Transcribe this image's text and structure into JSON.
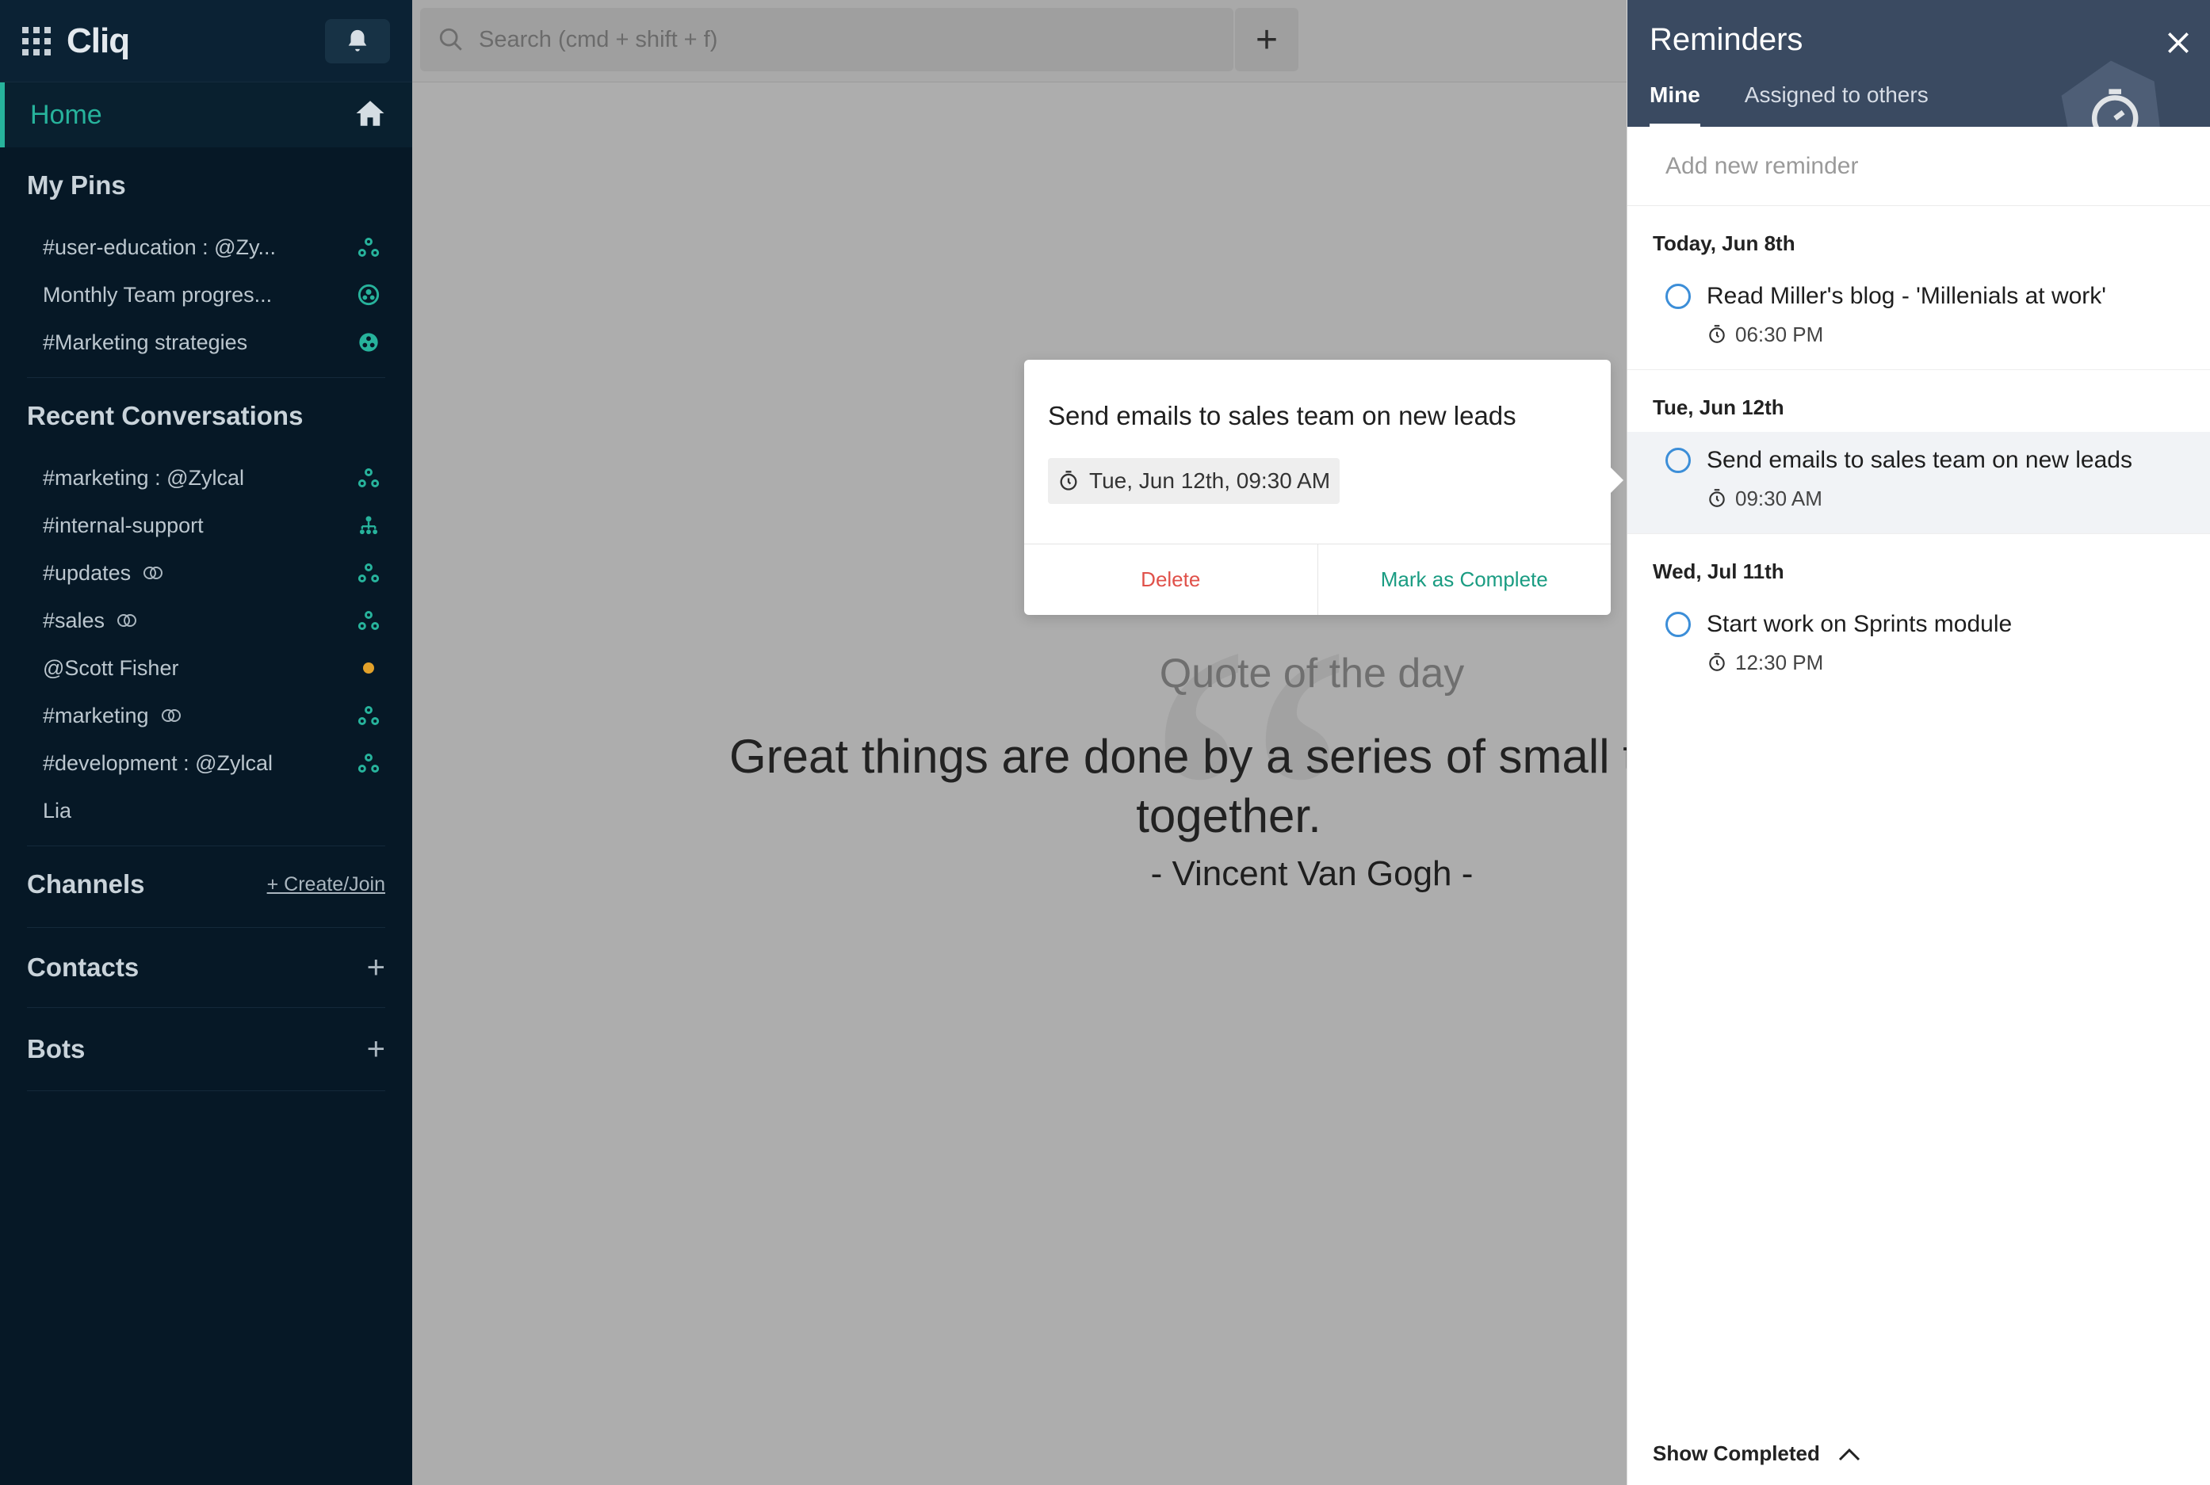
{
  "app": {
    "name": "Cliq"
  },
  "sidebar": {
    "home_label": "Home",
    "pins_title": "My Pins",
    "pins": [
      {
        "label": "#user-education : @Zy...",
        "icon": "channel-group-icon"
      },
      {
        "label": "Monthly Team progres...",
        "icon": "team-circle-icon"
      },
      {
        "label": "#Marketing strategies",
        "icon": "channel-circle-icon"
      }
    ],
    "recent_title": "Recent Conversations",
    "recent": [
      {
        "label": "#marketing : @Zylcal",
        "icon": "channel-group-icon"
      },
      {
        "label": "#internal-support",
        "icon": "org-tree-icon"
      },
      {
        "label": "#updates",
        "icon": "channel-group-icon",
        "linked": true
      },
      {
        "label": "#sales",
        "icon": "channel-group-icon",
        "linked": true
      },
      {
        "label": "@Scott Fisher",
        "icon": "presence-away-icon"
      },
      {
        "label": "#marketing",
        "icon": "channel-group-icon",
        "linked": true
      },
      {
        "label": "#development : @Zylcal",
        "icon": "channel-group-icon"
      },
      {
        "label": "Lia",
        "icon": ""
      }
    ],
    "channels_title": "Channels",
    "channels_action": "+ Create/Join",
    "contacts_title": "Contacts",
    "bots_title": "Bots",
    "accent_color": "#27b39c"
  },
  "search": {
    "placeholder": "Search (cmd + shift + f)"
  },
  "quote": {
    "title": "Quote of the day",
    "line1": "Great things are done by a series of small things brought",
    "line2": "together.",
    "author": "- Vincent Van Gogh -"
  },
  "popup": {
    "title": "Send emails to sales team on new leads",
    "datetime": "Tue, Jun 12th, 09:30 AM",
    "delete_label": "Delete",
    "complete_label": "Mark as Complete"
  },
  "reminders": {
    "title": "Reminders",
    "tabs": [
      {
        "label": "Mine",
        "active": true
      },
      {
        "label": "Assigned to others",
        "active": false
      }
    ],
    "add_placeholder": "Add new reminder",
    "groups": [
      {
        "heading": "Today, Jun 8th",
        "items": [
          {
            "title": "Read Miller's blog - 'Millenials at work'",
            "time": "06:30 PM"
          }
        ]
      },
      {
        "heading": "Tue, Jun 12th",
        "items": [
          {
            "title": "Send emails to sales team on new leads",
            "time": "09:30 AM",
            "selected": true
          }
        ]
      },
      {
        "heading": "Wed, Jul 11th",
        "items": [
          {
            "title": "Start work on Sprints module",
            "time": "12:30 PM"
          }
        ]
      }
    ],
    "show_completed": "Show Completed"
  }
}
